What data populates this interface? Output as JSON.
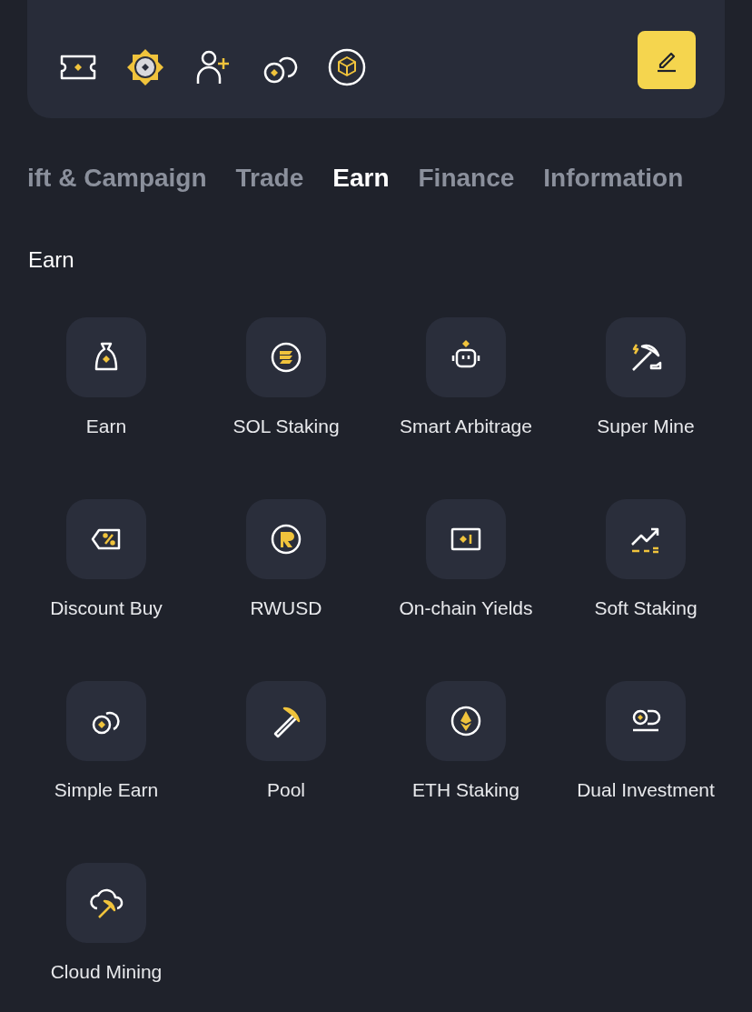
{
  "tabs": [
    {
      "label": "ift & Campaign",
      "selected": false
    },
    {
      "label": "Trade",
      "selected": false
    },
    {
      "label": "Earn",
      "selected": true
    },
    {
      "label": "Finance",
      "selected": false
    },
    {
      "label": "Information",
      "selected": false
    }
  ],
  "section": {
    "title": "Earn",
    "items": [
      {
        "label": "Earn"
      },
      {
        "label": "SOL Staking"
      },
      {
        "label": "Smart Arbitrage"
      },
      {
        "label": "Super Mine"
      },
      {
        "label": "Discount Buy"
      },
      {
        "label": "RWUSD"
      },
      {
        "label": "On-chain Yields"
      },
      {
        "label": "Soft Staking"
      },
      {
        "label": "Simple Earn"
      },
      {
        "label": "Pool"
      },
      {
        "label": "ETH Staking"
      },
      {
        "label": "Dual Investment"
      },
      {
        "label": "Cloud Mining"
      }
    ]
  }
}
